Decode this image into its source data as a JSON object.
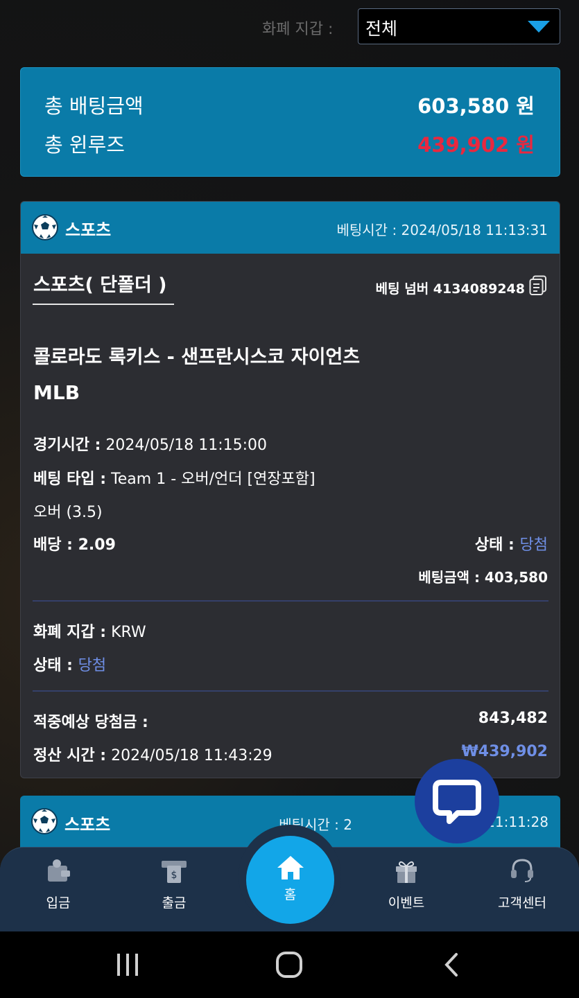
{
  "filter": {
    "label": "화폐 지갑 :",
    "selected": "전체"
  },
  "summary": {
    "total_bet_label": "총 배팅금액",
    "total_bet_amount": "603,580 원",
    "total_winloss_label": "총 윈루즈",
    "total_winloss_amount": "439,902 원",
    "colors": {
      "winloss": "#e8283f"
    }
  },
  "card": {
    "category": "스포츠",
    "bet_time": "베팅시간 : 2024/05/18 11:13:31",
    "bet_type": "스포츠( 단폴더 )",
    "bet_number": "베팅 넘버 4134089248",
    "match": "콜로라도 록키스 - 샌프란시스코 자이언츠",
    "league": "MLB",
    "game_time_label": "경기시간 :",
    "game_time_value": " 2024/05/18 11:15:00",
    "bet_kind_label": "베팅 타입 :",
    "bet_kind_value": " Team 1 - 오버/언더 [연장포함]",
    "pick": "오버 (3.5)",
    "odds_label": "배당 :",
    "odds_value": " 2.09",
    "status_label": "상태 : ",
    "status_value": "당첨",
    "bet_amount_label": "베팅금액 :",
    "bet_amount_value": " 403,580",
    "wallet_label": "화폐 지갑 :",
    "wallet_value": " KRW",
    "status2_label": "상태 : ",
    "status2_value": "당첨",
    "expected_win_label": "적중예상 당첨금 :",
    "expected_win_value": "843,482",
    "settle_time_label": "정산 시간 :",
    "settle_time_value": " 2024/05/18 11:43:29",
    "settle_amount": "₩439,902"
  },
  "card2": {
    "category": "스포츠",
    "bet_time_prefix": "베팅시간 : 2",
    "bet_time_suffix": "11:11:28"
  },
  "nav": {
    "items": [
      {
        "label": "입금",
        "icon": "wallet-icon"
      },
      {
        "label": "출금",
        "icon": "cash-withdraw-icon"
      },
      {
        "label": "홈",
        "icon": "home-icon"
      },
      {
        "label": "이벤트",
        "icon": "gift-icon"
      },
      {
        "label": "고객센터",
        "icon": "headset-icon"
      }
    ]
  },
  "system_nav": [
    "recent-apps-icon",
    "home-circle-icon",
    "back-icon"
  ]
}
